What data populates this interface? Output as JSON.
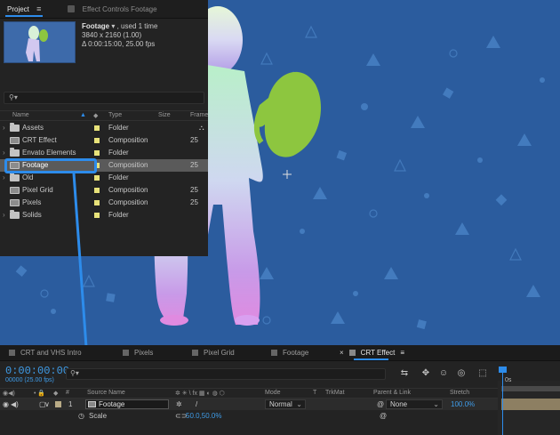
{
  "project_panel": {
    "tab_project": "Project",
    "tab_effect_controls": "Effect Controls Footage",
    "selected_item": {
      "name": "Footage",
      "usage": ", used 1 time",
      "dimensions": "3840 x 2160 (1.00)",
      "duration": "Δ 0:00:15:00, 25.00 fps"
    },
    "search_icon": "search-icon",
    "columns": {
      "name": "Name",
      "type": "Type",
      "size": "Size",
      "frame": "Frame"
    },
    "items": [
      {
        "name": "Assets",
        "type": "Folder",
        "frame": "",
        "kind": "folder",
        "selected": false
      },
      {
        "name": "CRT Effect",
        "type": "Composition",
        "frame": "25",
        "kind": "comp",
        "selected": false
      },
      {
        "name": "Envato Elements",
        "type": "Folder",
        "frame": "",
        "kind": "folder",
        "selected": false
      },
      {
        "name": "Footage",
        "type": "Composition",
        "frame": "25",
        "kind": "comp",
        "selected": true
      },
      {
        "name": "Old",
        "type": "Folder",
        "frame": "",
        "kind": "folder",
        "selected": false
      },
      {
        "name": "Pixel Grid",
        "type": "Composition",
        "frame": "25",
        "kind": "comp",
        "selected": false
      },
      {
        "name": "Pixels",
        "type": "Composition",
        "frame": "25",
        "kind": "comp",
        "selected": false
      },
      {
        "name": "Solids",
        "type": "Folder",
        "frame": "",
        "kind": "folder",
        "selected": false
      }
    ],
    "label_color": "#e8e27a"
  },
  "timeline": {
    "tabs": [
      "CRT and VHS Intro",
      "Pixels",
      "Pixel Grid",
      "Footage",
      "CRT Effect"
    ],
    "active_tab": "CRT Effect",
    "timecode": "0:00:00:00",
    "fps": "00000 (25.00 fps)",
    "search_placeholder": "",
    "headers": {
      "source_name": "Source Name",
      "mode": "Mode",
      "t": "T",
      "trkmat": "TrkMat",
      "parent_link": "Parent & Link",
      "stretch": "Stretch"
    },
    "layer": {
      "number": "1",
      "name": "Footage",
      "mode": "Normal",
      "parent": "None",
      "stretch": "100.0%"
    },
    "property": {
      "name": "Scale",
      "value": "50.0,50.0%"
    },
    "ruler_label": "0s"
  },
  "colors": {
    "accent": "#2d8ceb",
    "viewer_bg": "#2a5a9c",
    "panel_bg": "#232323"
  }
}
